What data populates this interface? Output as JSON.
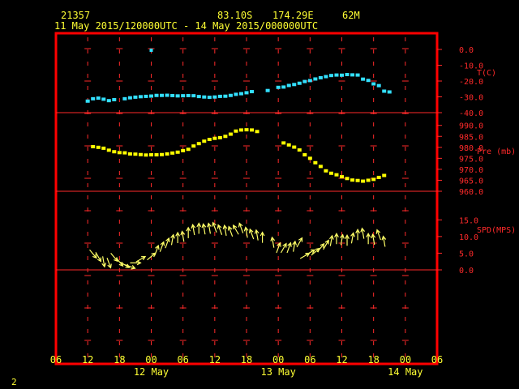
{
  "header": {
    "station": "21357",
    "lat": "83.10S",
    "lon": "174.29E",
    "elev": "62M",
    "range": "11 May 2015/120000UTC - 14 May 2015/000000UTC"
  },
  "footer": {
    "page_number": "2"
  },
  "colors": {
    "frame": "#ff0000",
    "text": "#ffff33",
    "temp": "#33e0ff",
    "pres": "#ffff00",
    "wind": "#ffff66",
    "grid": "#ff2a2a"
  },
  "chart_data": {
    "type": "scatter",
    "x_axis": {
      "unit": "hours",
      "range": [
        6,
        78
      ],
      "tick_labels": [
        "06",
        "12",
        "18",
        "00",
        "06",
        "12",
        "18",
        "00",
        "06",
        "12",
        "18",
        "00",
        "06"
      ],
      "date_labels": [
        {
          "hour": 24,
          "label": "12 May"
        },
        {
          "hour": 48,
          "label": "13 May"
        },
        {
          "hour": 72,
          "label": "14 May"
        }
      ]
    },
    "panels": [
      {
        "name": "temperature",
        "label": "T(C)",
        "y_ticks": [
          "0.0",
          "-10.0",
          "-20.0",
          "-30.0",
          "-40.0"
        ],
        "y_range": [
          -40,
          0
        ],
        "points": [
          [
            12,
            -32.7
          ],
          [
            13,
            -31.2
          ],
          [
            14,
            -30.8
          ],
          [
            15,
            -31.5
          ],
          [
            16,
            -32.4
          ],
          [
            17,
            -31.8
          ],
          [
            19,
            -31.2
          ],
          [
            20,
            -30.6
          ],
          [
            21,
            -30.2
          ],
          [
            22,
            -29.9
          ],
          [
            23,
            -29.7
          ],
          [
            24,
            -29.5
          ],
          [
            25,
            -29.1
          ],
          [
            26,
            -29.1
          ],
          [
            27,
            -29.0
          ],
          [
            28,
            -29.2
          ],
          [
            29,
            -29.4
          ],
          [
            30,
            -29.3
          ],
          [
            31,
            -29.2
          ],
          [
            32,
            -29.3
          ],
          [
            33,
            -29.8
          ],
          [
            34,
            -30.1
          ],
          [
            35,
            -30.3
          ],
          [
            36,
            -30.1
          ],
          [
            37,
            -29.7
          ],
          [
            38,
            -29.6
          ],
          [
            39,
            -29.1
          ],
          [
            40,
            -28.4
          ],
          [
            41,
            -28.0
          ],
          [
            42,
            -27.4
          ],
          [
            43,
            -26.7
          ],
          [
            46,
            -26.0
          ],
          [
            48,
            -24.0
          ],
          [
            49,
            -23.8
          ],
          [
            50,
            -22.8
          ],
          [
            51,
            -22.2
          ],
          [
            52,
            -21.4
          ],
          [
            53,
            -20.3
          ],
          [
            54,
            -19.7
          ],
          [
            55,
            -18.7
          ],
          [
            56,
            -17.9
          ],
          [
            57,
            -17.2
          ],
          [
            58,
            -16.5
          ],
          [
            59,
            -16.2
          ],
          [
            60,
            -16.3
          ],
          [
            61,
            -15.9
          ],
          [
            62,
            -16.1
          ],
          [
            63,
            -16.2
          ],
          [
            64,
            -18.8
          ],
          [
            65,
            -19.6
          ],
          [
            66,
            -21.8
          ],
          [
            67,
            -22.9
          ],
          [
            68,
            -26.4
          ],
          [
            69,
            -26.9
          ]
        ],
        "outlier": [
          24,
          -0.5
        ]
      },
      {
        "name": "pressure",
        "label": "Pre (mb)",
        "y_ticks": [
          "990.0",
          "985.0",
          "980.0",
          "975.0",
          "970.0",
          "965.0",
          "960.0"
        ],
        "y_range": [
          960,
          991
        ],
        "points": [
          [
            13,
            980.3
          ],
          [
            14,
            980.0
          ],
          [
            15,
            979.6
          ],
          [
            16,
            978.7
          ],
          [
            17,
            978.0
          ],
          [
            18,
            977.6
          ],
          [
            19,
            977.5
          ],
          [
            20,
            977.0
          ],
          [
            21,
            976.9
          ],
          [
            22,
            976.7
          ],
          [
            23,
            976.5
          ],
          [
            24,
            976.6
          ],
          [
            25,
            976.6
          ],
          [
            26,
            976.7
          ],
          [
            27,
            977.0
          ],
          [
            28,
            977.4
          ],
          [
            29,
            977.8
          ],
          [
            30,
            978.5
          ],
          [
            31,
            979.1
          ],
          [
            32,
            980.6
          ],
          [
            33,
            981.7
          ],
          [
            34,
            982.8
          ],
          [
            35,
            983.6
          ],
          [
            36,
            984.1
          ],
          [
            37,
            984.4
          ],
          [
            38,
            985.0
          ],
          [
            39,
            986.0
          ],
          [
            40,
            987.4
          ],
          [
            41,
            987.9
          ],
          [
            42,
            988.0
          ],
          [
            43,
            987.9
          ],
          [
            44,
            987.2
          ],
          [
            49,
            982.0
          ],
          [
            50,
            981.1
          ],
          [
            51,
            980.1
          ],
          [
            52,
            978.8
          ],
          [
            53,
            976.6
          ],
          [
            54,
            975.0
          ],
          [
            55,
            973.0
          ],
          [
            56,
            971.3
          ],
          [
            57,
            969.3
          ],
          [
            58,
            968.2
          ],
          [
            59,
            967.5
          ],
          [
            60,
            966.6
          ],
          [
            61,
            965.8
          ],
          [
            62,
            965.1
          ],
          [
            63,
            964.9
          ],
          [
            64,
            964.6
          ],
          [
            65,
            965.0
          ],
          [
            66,
            965.4
          ],
          [
            67,
            966.3
          ],
          [
            68,
            967.2
          ]
        ]
      },
      {
        "name": "wind",
        "label": "SPD(MPS)",
        "y_ticks": [
          "15.0",
          "10.0",
          "5.0",
          "0.0"
        ],
        "y_range": [
          0,
          17.5
        ],
        "arrows": [
          [
            13,
            4.8,
            320
          ],
          [
            14,
            3.9,
            330
          ],
          [
            15,
            2.5,
            350
          ],
          [
            16,
            2.1,
            340
          ],
          [
            17,
            3.8,
            320
          ],
          [
            18,
            2.4,
            320
          ],
          [
            19,
            1.5,
            300
          ],
          [
            20,
            1.0,
            290
          ],
          [
            21,
            2.1,
            270
          ],
          [
            22,
            3.2,
            240
          ],
          [
            24,
            4.0,
            230
          ],
          [
            25,
            5.8,
            200
          ],
          [
            26,
            6.9,
            200
          ],
          [
            27,
            8.0,
            200
          ],
          [
            28,
            9.0,
            190
          ],
          [
            29,
            9.6,
            180
          ],
          [
            30,
            10.0,
            170
          ],
          [
            31,
            11.1,
            180
          ],
          [
            32,
            12.0,
            170
          ],
          [
            33,
            12.4,
            180
          ],
          [
            34,
            12.2,
            170
          ],
          [
            35,
            12.4,
            170
          ],
          [
            36,
            12.7,
            160
          ],
          [
            37,
            12.0,
            160
          ],
          [
            38,
            11.8,
            170
          ],
          [
            39,
            11.5,
            160
          ],
          [
            40,
            12.0,
            150
          ],
          [
            41,
            12.5,
            160
          ],
          [
            42,
            11.2,
            170
          ],
          [
            43,
            10.7,
            160
          ],
          [
            44,
            10.4,
            170
          ],
          [
            45,
            9.7,
            180
          ],
          [
            47,
            8.2,
            170
          ],
          [
            48,
            6.6,
            200
          ],
          [
            49,
            6.5,
            210
          ],
          [
            50,
            6.6,
            200
          ],
          [
            51,
            7.0,
            190
          ],
          [
            52,
            8.2,
            210
          ],
          [
            53,
            4.2,
            240
          ],
          [
            54,
            5.2,
            240
          ],
          [
            55,
            5.4,
            230
          ],
          [
            56,
            6.6,
            220
          ],
          [
            57,
            7.5,
            210
          ],
          [
            58,
            8.7,
            190
          ],
          [
            59,
            9.3,
            180
          ],
          [
            60,
            9.0,
            190
          ],
          [
            61,
            8.8,
            180
          ],
          [
            62,
            9.5,
            190
          ],
          [
            63,
            10.5,
            180
          ],
          [
            64,
            10.9,
            170
          ],
          [
            65,
            9.3,
            180
          ],
          [
            66,
            9.1,
            170
          ],
          [
            67,
            10.5,
            160
          ],
          [
            68,
            8.5,
            170
          ]
        ]
      }
    ]
  }
}
